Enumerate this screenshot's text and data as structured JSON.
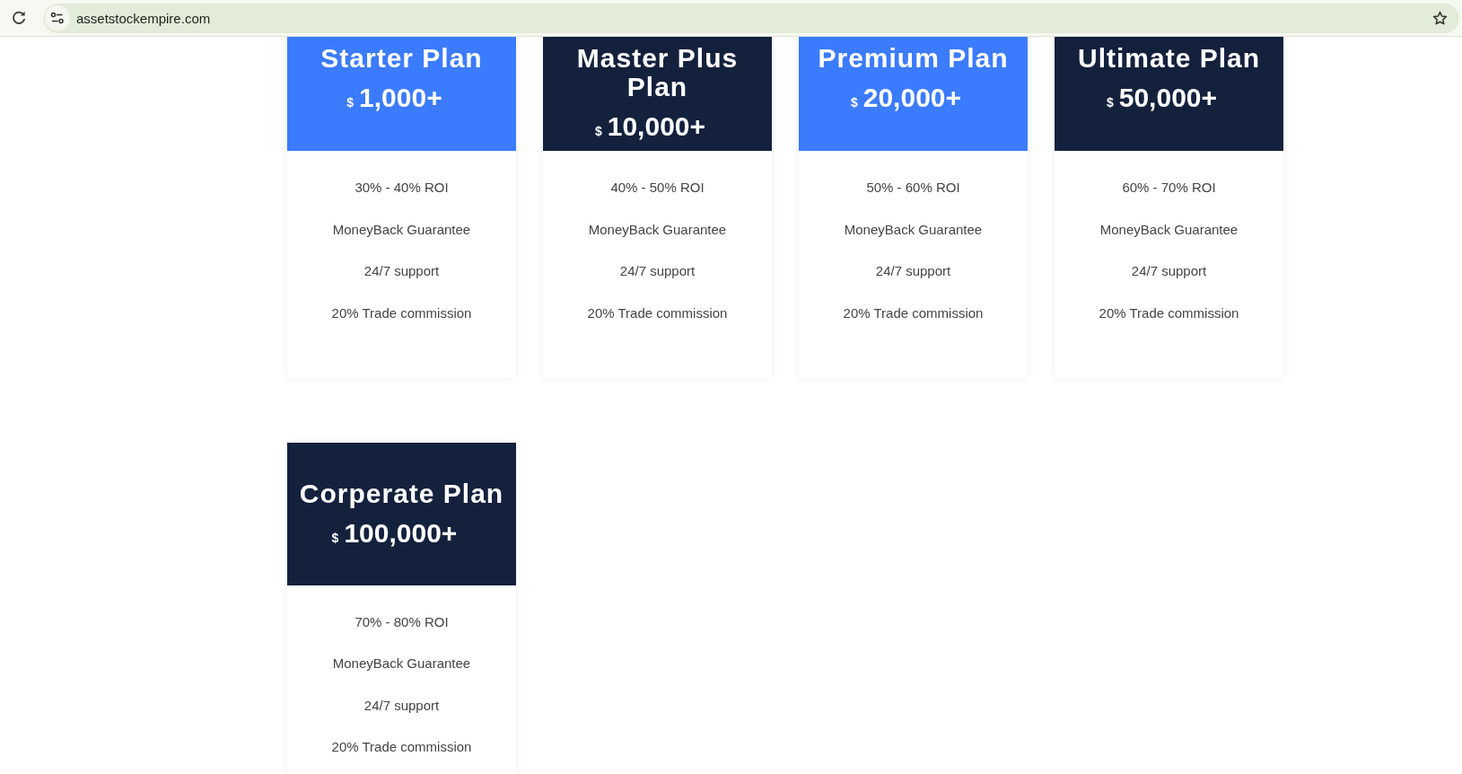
{
  "browser": {
    "url": "assetstockempire.com"
  },
  "plans": [
    {
      "name": "Starter Plan",
      "currency": "$",
      "amount": "1,000+",
      "color": "#3b7bfe",
      "features": [
        "30% - 40% ROI",
        "MoneyBack Guarantee",
        "24/7 support",
        "20% Trade commission"
      ]
    },
    {
      "name": "Master Plus Plan",
      "currency": "$",
      "amount": "10,000+",
      "color": "#14213d",
      "features": [
        "40% - 50% ROI",
        "MoneyBack Guarantee",
        "24/7 support",
        "20% Trade commission"
      ]
    },
    {
      "name": "Premium Plan",
      "currency": "$",
      "amount": "20,000+",
      "color": "#3b7bfe",
      "features": [
        "50% - 60% ROI",
        "MoneyBack Guarantee",
        "24/7 support",
        "20% Trade commission"
      ]
    },
    {
      "name": "Ultimate Plan",
      "currency": "$",
      "amount": "50,000+",
      "color": "#14213d",
      "features": [
        "60% - 70% ROI",
        "MoneyBack Guarantee",
        "24/7 support",
        "20% Trade commission"
      ]
    },
    {
      "name": "Corperate Plan",
      "currency": "$",
      "amount": "100,000+",
      "color": "#14213d",
      "features": [
        "70% - 80% ROI",
        "MoneyBack Guarantee",
        "24/7 support",
        "20% Trade commission"
      ]
    }
  ]
}
